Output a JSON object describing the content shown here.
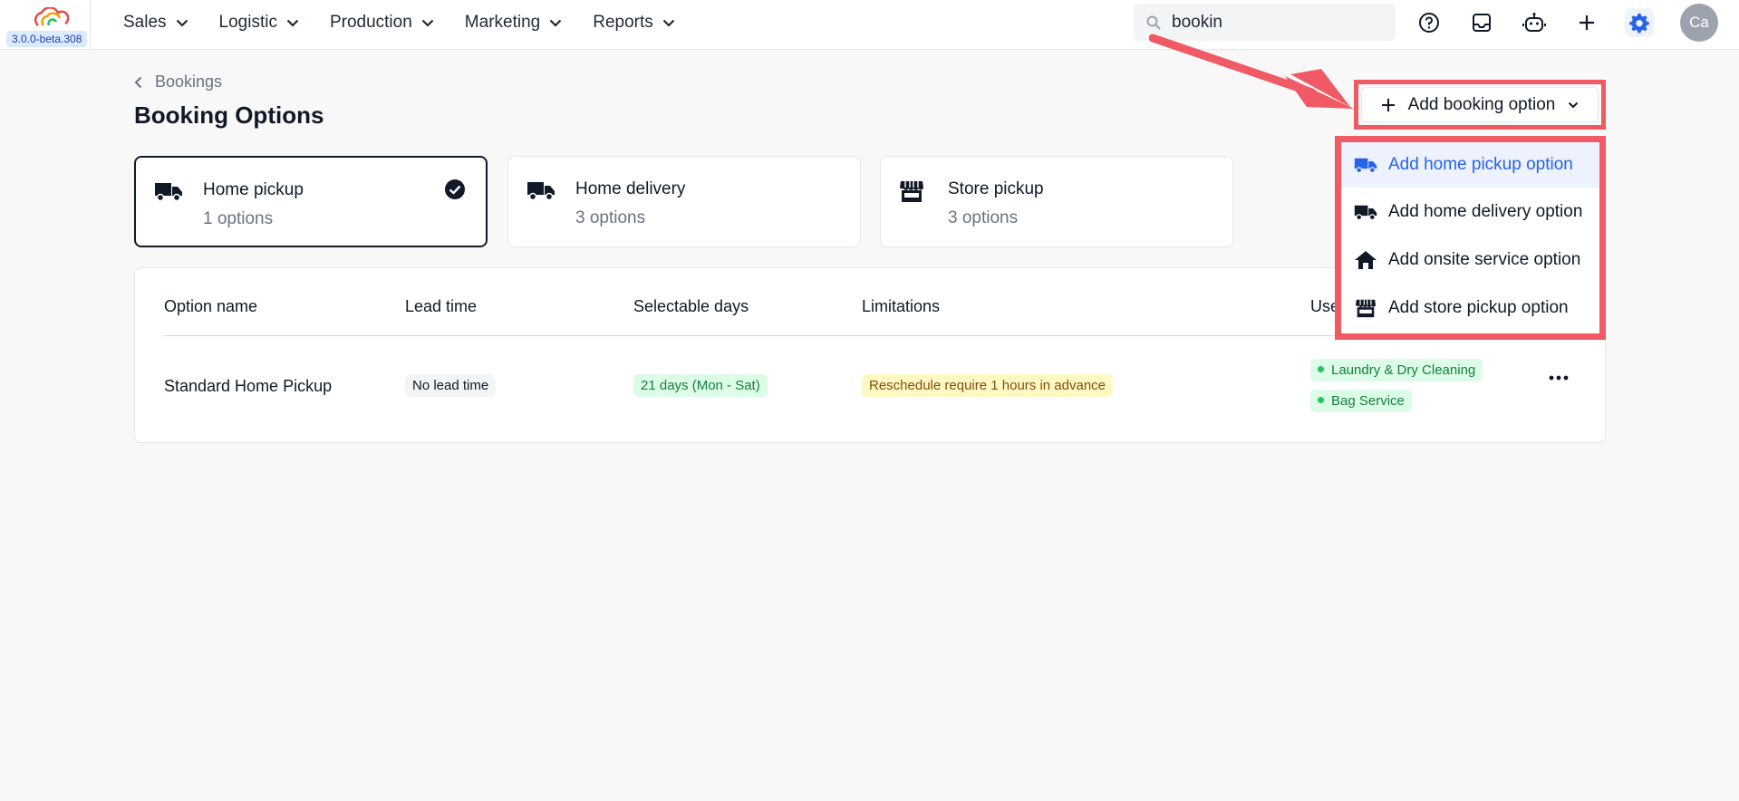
{
  "app": {
    "version": "3.0.0-beta.308"
  },
  "nav": {
    "items": [
      {
        "label": "Sales"
      },
      {
        "label": "Logistic"
      },
      {
        "label": "Production"
      },
      {
        "label": "Marketing"
      },
      {
        "label": "Reports"
      }
    ]
  },
  "search": {
    "value": "bookin"
  },
  "toolbar": {
    "icons": [
      "help-icon",
      "inbox-icon",
      "robot-icon",
      "plus-icon",
      "gear-icon"
    ],
    "avatar_initials": "Ca"
  },
  "breadcrumb": {
    "label": "Bookings"
  },
  "page": {
    "title": "Booking Options"
  },
  "categories": [
    {
      "title": "Home pickup",
      "subtitle": "1 options",
      "icon": "truck-icon",
      "selected": true
    },
    {
      "title": "Home delivery",
      "subtitle": "3 options",
      "icon": "truck-icon",
      "selected": false
    },
    {
      "title": "Store pickup",
      "subtitle": "3 options",
      "icon": "store-icon",
      "selected": false
    }
  ],
  "table": {
    "headers": [
      "Option name",
      "Lead time",
      "Selectable days",
      "Limitations",
      "Use"
    ],
    "rows": [
      {
        "name": "Standard Home Pickup",
        "lead_time": "No lead time",
        "selectable_days": "21 days (Mon - Sat)",
        "limitations": "Reschedule require 1 hours in advance",
        "used_for": [
          "Laundry & Dry Cleaning",
          "Bag Service"
        ]
      }
    ]
  },
  "add_button": {
    "label": "Add booking option"
  },
  "dropdown": {
    "items": [
      {
        "label": "Add home pickup option",
        "icon": "truck-icon",
        "active": true
      },
      {
        "label": "Add home delivery option",
        "icon": "truck-icon",
        "active": false
      },
      {
        "label": "Add onsite service option",
        "icon": "home-icon",
        "active": false
      },
      {
        "label": "Add store pickup option",
        "icon": "store-icon",
        "active": false
      }
    ]
  },
  "colors": {
    "accent": "#2563eb",
    "annotation": "#ef5a64",
    "tag_green_bg": "#dcfce7",
    "tag_yellow_bg": "#fef9c3"
  }
}
